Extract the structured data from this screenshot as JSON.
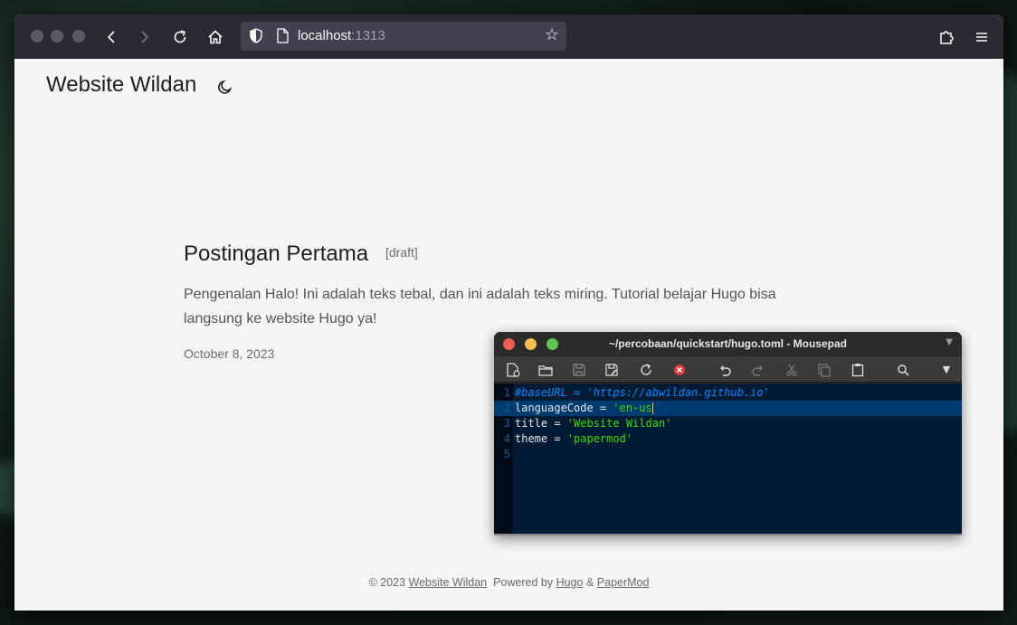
{
  "browser": {
    "url_host": "localhost",
    "url_port": ":1313"
  },
  "site": {
    "title": "Website Wildan"
  },
  "post": {
    "title": "Postingan Pertama",
    "badge": "[draft]",
    "summary": "Pengenalan Halo! Ini adalah teks tebal, dan ini adalah teks miring. Tutorial belajar Hugo bisa langsung ke website Hugo ya!",
    "date": "October 8, 2023"
  },
  "footer": {
    "copyright": "© 2023",
    "site_link": "Website Wildan",
    "powered_by": "Powered by",
    "hugo_link": "Hugo",
    "amp": "&",
    "theme_link": "PaperMod"
  },
  "editor": {
    "title": "~/percobaan/quickstart/hugo.toml - Mousepad",
    "lines": [
      {
        "n": "1",
        "key": "",
        "comment": "#baseURL = 'https://abwildan.github.io'",
        "string": ""
      },
      {
        "n": "2",
        "key": "languageCode = ",
        "comment": "",
        "string": "'en-us"
      },
      {
        "n": "3",
        "key": "title = ",
        "comment": "",
        "string": "'Website Wildan'"
      },
      {
        "n": "4",
        "key": "theme = ",
        "comment": "",
        "string": "'papermod'"
      },
      {
        "n": "5",
        "key": "",
        "comment": "",
        "string": ""
      }
    ]
  },
  "colors": {
    "browser_chrome": "#2b2a33",
    "page_bg": "#f5f5f5",
    "editor_bg": "#001b33",
    "close_red": "#ed5e53",
    "minimize_yellow": "#f4bf4f",
    "maximize_green": "#5fc454"
  }
}
